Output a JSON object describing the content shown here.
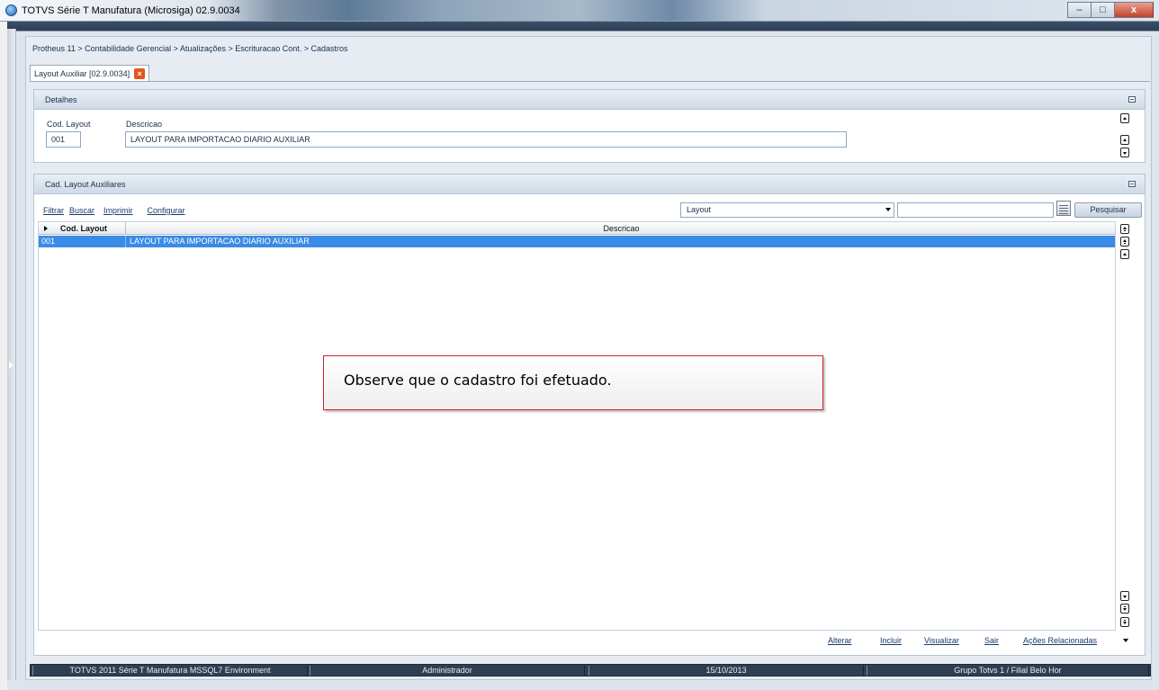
{
  "window": {
    "title": "TOTVS Série T Manufatura (Microsiga) 02.9.0034",
    "minimize_symbol": "–",
    "maximize_symbol": "□",
    "close_symbol": "x"
  },
  "breadcrumb": "Protheus 11 > Contabilidade Gerencial > Atualizações > Escrituracao Cont. > Cadastros",
  "tab": {
    "label": "Layout Auxiliar [02.9.0034]",
    "close_symbol": "×"
  },
  "details": {
    "header": "Detalhes",
    "fields": [
      {
        "label": "Cod. Layout",
        "value": "001"
      },
      {
        "label": "Descricao",
        "value": "LAYOUT PARA IMPORTACAO DIARIO AUXILIAR"
      }
    ]
  },
  "list_panel": {
    "header": "Cad. Layout Auxiliares",
    "links": [
      "Filtrar",
      "Buscar",
      "Imprimir",
      "Configurar"
    ],
    "search_field_select": "Layout",
    "search_value": "",
    "search_button": "Pesquisar",
    "columns": [
      "Cod. Layout",
      "Descricao"
    ],
    "rows": [
      {
        "cod": "001",
        "descricao": "LAYOUT PARA IMPORTACAO DIARIO AUXILIAR",
        "selected": true
      }
    ]
  },
  "callout": {
    "text": "Observe que o cadastro foi efetuado.",
    "border_color": "#d2232a"
  },
  "actions": [
    "Alterar",
    "Incluir",
    "Visualizar",
    "Sair",
    "Ações Relacionadas"
  ],
  "status_bar": [
    "TOTVS 2011 Série T Manufatura MSSQL7 Environment",
    "Administrador",
    "15/10/2013",
    "Grupo Totvs 1 / Filial Belo Hor"
  ],
  "icons": {
    "app": "totvs-logo-icon",
    "collapse": "collapse-panel-icon",
    "search_settings": "notepad-icon",
    "select_arrow": "chevron-down-icon"
  },
  "colors": {
    "selected_row": "#3a8be6",
    "tab_close": "#e0561e",
    "status_bar": "#2f3f52"
  }
}
